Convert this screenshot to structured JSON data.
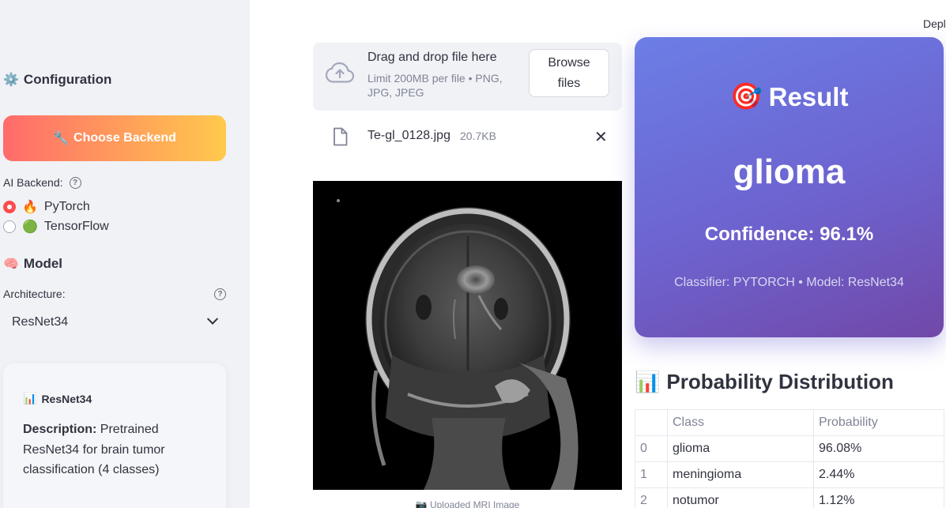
{
  "header": {
    "deploy_label": "Depl"
  },
  "sidebar": {
    "config_heading": "Configuration",
    "config_icon": "gear-icon",
    "backend_button": "Choose Backend",
    "backend_button_icon": "wrench-icon",
    "backend_label": "AI Backend:",
    "backend_options": [
      {
        "label": "PyTorch",
        "icon": "fire-icon",
        "selected": true
      },
      {
        "label": "TensorFlow",
        "icon": "green-circle-icon",
        "selected": false
      }
    ],
    "model_heading": "Model",
    "model_icon": "brain-icon",
    "architecture_label": "Architecture:",
    "architecture_value": "ResNet34",
    "info_card": {
      "title": "ResNet34",
      "title_icon": "bar-chart-icon",
      "description_label": "Description:",
      "description_text": " Pretrained ResNet34 for brain tumor classification (4 classes)"
    }
  },
  "uploader": {
    "drop_title": "Drag and drop file here",
    "drop_limit": "Limit 200MB per file • PNG, JPG, JPEG",
    "browse_label": "Browse files",
    "file_name": "Te-gl_0128.jpg",
    "file_size": "20.7KB",
    "image_caption": "Uploaded MRI Image"
  },
  "result": {
    "title": "Result",
    "title_icon": "target-icon",
    "predicted_class": "glioma",
    "confidence": "Confidence: 96.1%",
    "meta": "Classifier: PYTORCH • Model: ResNet34"
  },
  "probabilities": {
    "heading": "Probability Distribution",
    "heading_icon": "bar-chart-icon",
    "columns": [
      "",
      "Class",
      "Probability"
    ],
    "rows": [
      {
        "index": "0",
        "class": "glioma",
        "probability": "96.08%"
      },
      {
        "index": "1",
        "class": "meningioma",
        "probability": "2.44%"
      },
      {
        "index": "2",
        "class": "notumor",
        "probability": "1.12%"
      }
    ]
  },
  "colors": {
    "accent_red": "#ff4b4b",
    "sidebar_bg": "#f0f2f6",
    "result_gradient_start": "#6c7ee6",
    "result_gradient_end": "#7148a8"
  }
}
